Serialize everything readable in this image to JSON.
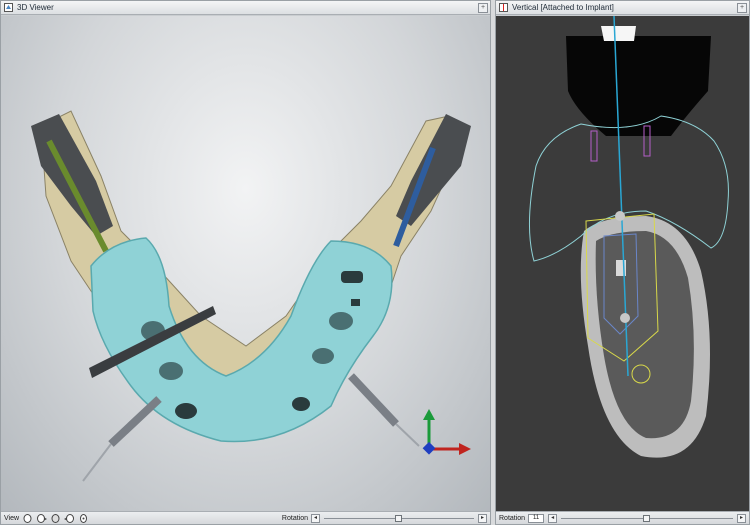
{
  "left_panel": {
    "title": "3D Viewer",
    "status": {
      "view_label": "View",
      "view_icons": [
        "head-front-icon",
        "head-side-icon",
        "head-back-icon",
        "head-left-icon",
        "head-top-icon"
      ],
      "rotation_label": "Rotation",
      "rotation_position": 0.5
    }
  },
  "right_panel": {
    "title": "Vertical [Attached to Implant]",
    "status": {
      "rotation_label": "Rotation",
      "rotation_value": "11",
      "rotation_position": 0.5
    }
  },
  "colors": {
    "guide": "#8fd2d6",
    "implant_axis": "#2aa7d4",
    "safety_zone": "#d8d84a",
    "nerve": "#b55fc9",
    "axis_x": "#c0241f",
    "axis_y": "#1a9a3a",
    "axis_z": "#1f3ec0"
  }
}
